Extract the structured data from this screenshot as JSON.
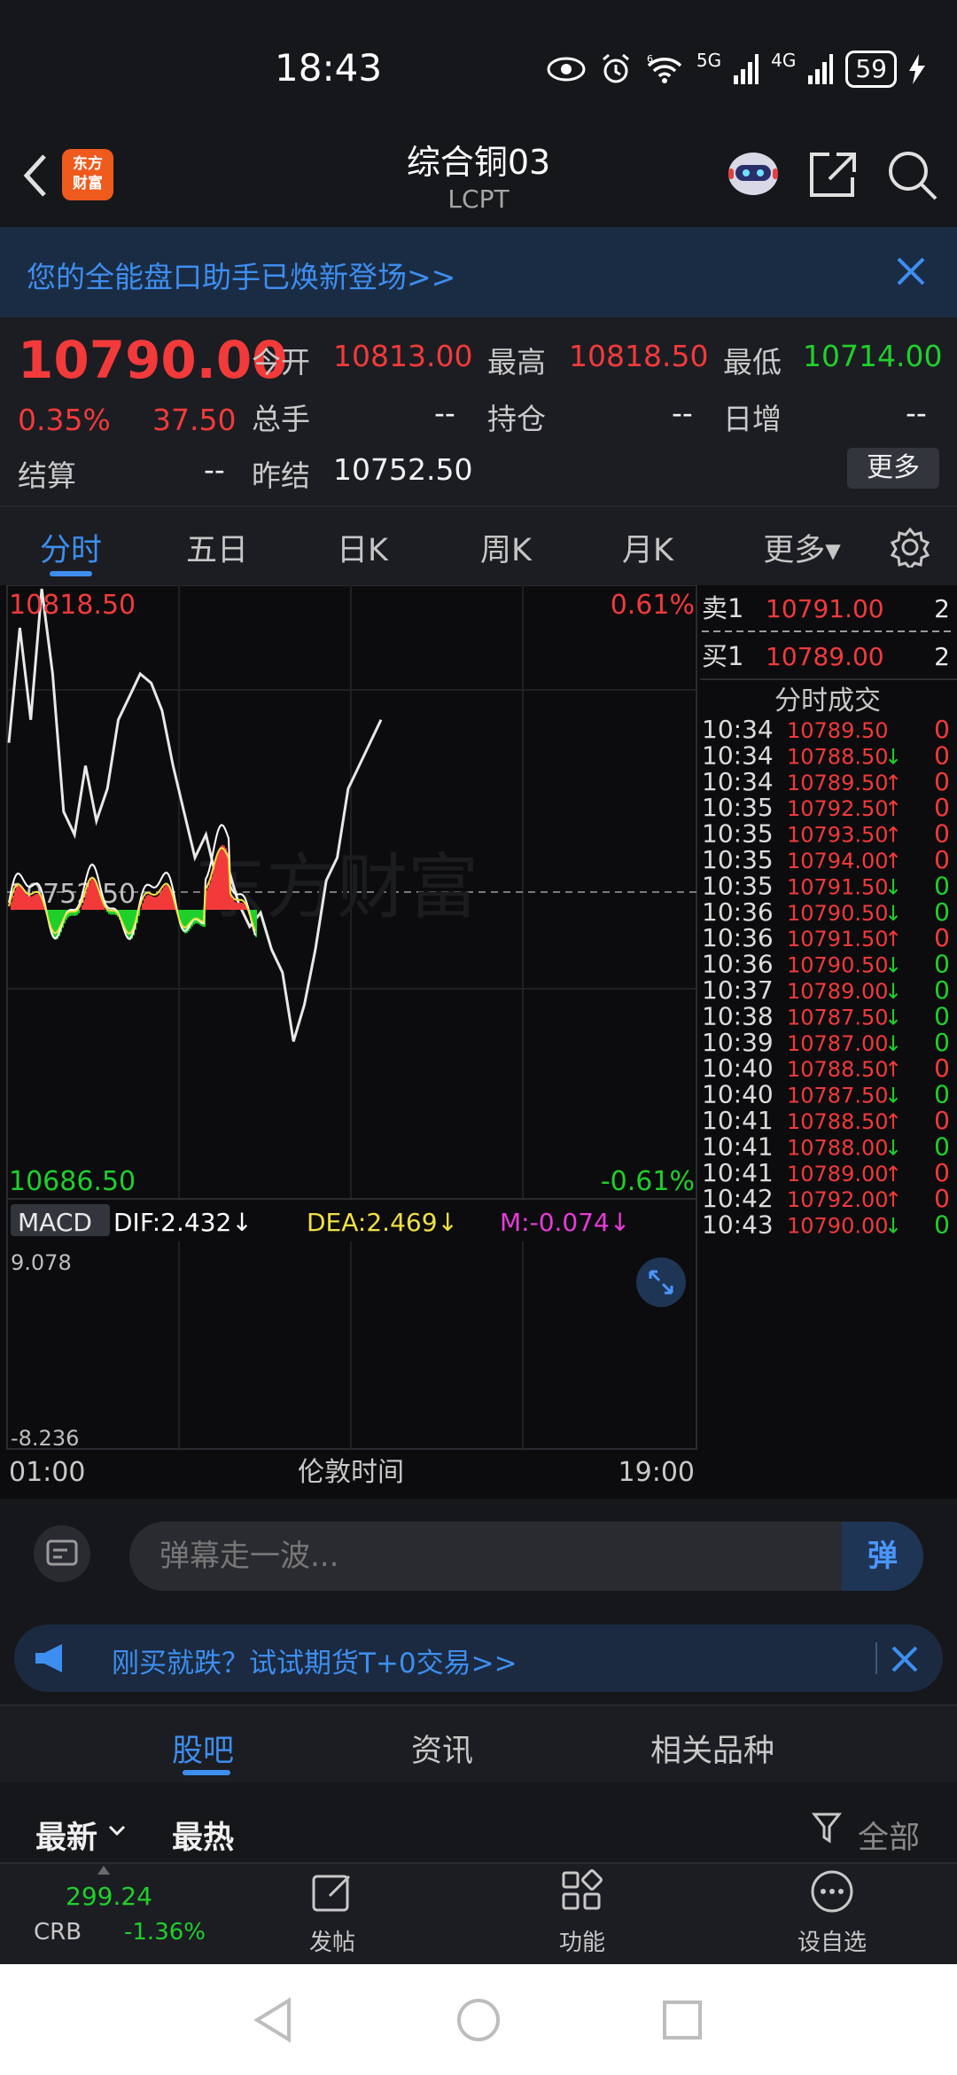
{
  "status_bar": {
    "time": "18:43",
    "battery": "59",
    "net_5g": "5G",
    "net_4g": "4G",
    "wifi_badge": "6"
  },
  "header": {
    "title": "综合铜03",
    "subtitle": "LCPT",
    "logo_text_1": "东方",
    "logo_text_2": "财富"
  },
  "banner": {
    "text": "您的全能盘口助手已焕新登场>>"
  },
  "quote": {
    "price": "10790.00",
    "change_pct": "0.35%",
    "change": "37.50",
    "open_label": "今开",
    "open": "10813.00",
    "high_label": "最高",
    "high": "10818.50",
    "low_label": "最低",
    "low": "10714.00",
    "volume_label": "总手",
    "volume": "--",
    "oi_label": "持仓",
    "oi": "--",
    "daily_inc_label": "日增",
    "daily_inc": "--",
    "settle_label": "结算",
    "settle": "--",
    "prev_settle_label": "昨结",
    "prev_settle": "10752.50",
    "more_label": "更多"
  },
  "tabs": [
    "分时",
    "五日",
    "日K",
    "周K",
    "月K",
    "更多▾"
  ],
  "chart": {
    "price_high_label": "10818.50",
    "price_low_label": "10686.50",
    "prev_settle_label": "10752.50",
    "pct_high": "0.61%",
    "pct_low": "-0.61%",
    "watermark": "东方财富",
    "x_start": "01:00",
    "x_mid": "伦敦时间",
    "x_end": "19:00",
    "macd_label": "MACD",
    "dif": "DIF:2.432↓",
    "dea": "DEA:2.469↓",
    "m": "M:-0.074↓",
    "macd_max": "9.078",
    "macd_min": "-8.236"
  },
  "chart_data": {
    "type": "line",
    "title": "",
    "x_range": [
      "01:00",
      "19:00"
    ],
    "ylim": [
      10686.5,
      10818.5
    ],
    "reference": 10752.5,
    "series": [
      {
        "values": [
          10785,
          10810,
          10790,
          10818.5,
          10800,
          10770,
          10765,
          10780,
          10768,
          10775,
          10790,
          10795,
          10800,
          10798,
          10792,
          10780,
          10770,
          10760,
          10765,
          10755,
          10758,
          10750,
          10745,
          10748,
          10740,
          10735,
          10720,
          10728,
          10740,
          10755,
          10760,
          10775,
          10780,
          10785,
          10790
        ]
      }
    ],
    "macd": {
      "ylim": [
        -8.236,
        9.078
      ]
    }
  },
  "order_book": {
    "sell_label": "卖1",
    "sell_price": "10791.00",
    "sell_vol": "2",
    "buy_label": "买1",
    "buy_price": "10789.00",
    "buy_vol": "2",
    "ticks_title": "分时成交"
  },
  "ticks": [
    {
      "time": "10:34",
      "price": "10789.50",
      "dir": "",
      "vol": "0",
      "vc": "red"
    },
    {
      "time": "10:34",
      "price": "10788.50",
      "dir": "↓",
      "vol": "0",
      "vc": "red"
    },
    {
      "time": "10:34",
      "price": "10789.50",
      "dir": "↑",
      "vol": "0",
      "vc": "red"
    },
    {
      "time": "10:35",
      "price": "10792.50",
      "dir": "↑",
      "vol": "0",
      "vc": "red"
    },
    {
      "time": "10:35",
      "price": "10793.50",
      "dir": "↑",
      "vol": "0",
      "vc": "red"
    },
    {
      "time": "10:35",
      "price": "10794.00",
      "dir": "↑",
      "vol": "0",
      "vc": "red"
    },
    {
      "time": "10:35",
      "price": "10791.50",
      "dir": "↓",
      "vol": "0",
      "vc": "green"
    },
    {
      "time": "10:36",
      "price": "10790.50",
      "dir": "↓",
      "vol": "0",
      "vc": "green"
    },
    {
      "time": "10:36",
      "price": "10791.50",
      "dir": "↑",
      "vol": "0",
      "vc": "red"
    },
    {
      "time": "10:36",
      "price": "10790.50",
      "dir": "↓",
      "vol": "0",
      "vc": "green"
    },
    {
      "time": "10:37",
      "price": "10789.00",
      "dir": "↓",
      "vol": "0",
      "vc": "green"
    },
    {
      "time": "10:38",
      "price": "10787.50",
      "dir": "↓",
      "vol": "0",
      "vc": "green"
    },
    {
      "time": "10:39",
      "price": "10787.00",
      "dir": "↓",
      "vol": "0",
      "vc": "green"
    },
    {
      "time": "10:40",
      "price": "10788.50",
      "dir": "↑",
      "vol": "0",
      "vc": "red"
    },
    {
      "time": "10:40",
      "price": "10787.50",
      "dir": "↓",
      "vol": "0",
      "vc": "green"
    },
    {
      "time": "10:41",
      "price": "10788.50",
      "dir": "↑",
      "vol": "0",
      "vc": "red"
    },
    {
      "time": "10:41",
      "price": "10788.00",
      "dir": "↓",
      "vol": "0",
      "vc": "green"
    },
    {
      "time": "10:41",
      "price": "10789.00",
      "dir": "↑",
      "vol": "0",
      "vc": "red"
    },
    {
      "time": "10:42",
      "price": "10792.00",
      "dir": "↑",
      "vol": "0",
      "vc": "red"
    },
    {
      "time": "10:43",
      "price": "10790.00",
      "dir": "↓",
      "vol": "0",
      "vc": "green"
    }
  ],
  "comment": {
    "placeholder": "弹幕走一波...",
    "danmu": "弹"
  },
  "ad": {
    "text": "刚买就跌？试试期货T+0交易>>"
  },
  "bottom_tabs": [
    "股吧",
    "资讯",
    "相关品种"
  ],
  "sort": {
    "latest": "最新",
    "hot": "最热",
    "filter": "全部"
  },
  "bottom_nav": {
    "crb_value": "299.24",
    "crb_label": "CRB",
    "crb_pct": "-1.36%",
    "post": "发帖",
    "func": "功能",
    "watchlist": "设自选"
  },
  "colors": {
    "up": "#f23a3a",
    "down": "#1fd02b",
    "accent": "#3d8ef0",
    "dif": "#ffffff",
    "dea": "#f0e046",
    "m": "#e83bd9"
  }
}
